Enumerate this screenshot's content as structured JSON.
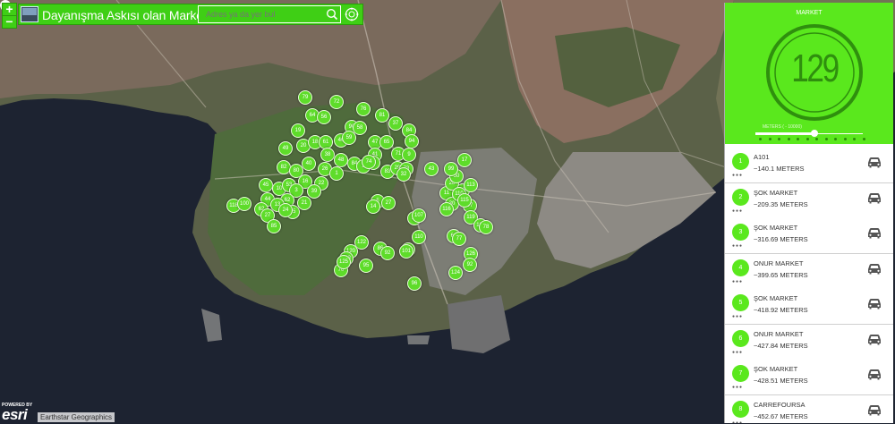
{
  "app": {
    "title": "Dayanışma Askısı olan Marketler",
    "zoom_in": "+",
    "zoom_out": "−",
    "search_placeholder": "Adres ya da yer bul",
    "icons": {
      "logo": "globe-logo-icon",
      "search": "search-icon",
      "locate": "locate-icon",
      "pin": "map-pin-icon"
    }
  },
  "map": {
    "powered_by": "POWERED BY",
    "esri_logo": "esri",
    "attribution": "Earthstar Geographics",
    "marker_color": "#5edc2a",
    "marker_labels": [
      "79",
      "72",
      "64",
      "56",
      "76",
      "81",
      "37",
      "90",
      "84",
      "58",
      "19",
      "46",
      "59",
      "94",
      "20",
      "49",
      "18",
      "61",
      "38",
      "47",
      "65",
      "41",
      "71",
      "9",
      "84",
      "63",
      "83",
      "29",
      "73",
      "48",
      "82",
      "40",
      "80",
      "26",
      "1",
      "2",
      "74",
      "22",
      "16",
      "39",
      "45",
      "10",
      "53",
      "3",
      "62",
      "44",
      "13",
      "35",
      "21",
      "62",
      "27",
      "24",
      "85",
      "118",
      "100",
      "5",
      "27",
      "14",
      "32",
      "43",
      "11",
      "30",
      "12",
      "107",
      "97",
      "15",
      "28",
      "50",
      "17",
      "99",
      "110",
      "113",
      "115",
      "119",
      "112",
      "78",
      "116",
      "68",
      "77",
      "11",
      "86",
      "122",
      "120",
      "123",
      "70",
      "125",
      "95",
      "92",
      "101",
      "126",
      "92",
      "124",
      "96",
      "110"
    ]
  },
  "panel": {
    "title": "MARKET",
    "count": "129",
    "slider_label": "METERS ( - 10000)",
    "slider_value": 0.55,
    "accent": "#5ae81d",
    "dots_count": 12,
    "list": [
      {
        "rank": "1",
        "name": "A101",
        "distance": "~140.1 METERS",
        "stars": "●●●"
      },
      {
        "rank": "2",
        "name": "ŞOK MARKET",
        "distance": "~209.35 METERS",
        "stars": "●●●"
      },
      {
        "rank": "3",
        "name": "ŞOK MARKET",
        "distance": "~316.69 METERS",
        "stars": "●●●"
      },
      {
        "rank": "4",
        "name": "ONUR MARKET",
        "distance": "~399.65 METERS",
        "stars": "●●●"
      },
      {
        "rank": "5",
        "name": "ŞOK MARKET",
        "distance": "~418.92 METERS",
        "stars": "●●●"
      },
      {
        "rank": "6",
        "name": "ONUR MARKET",
        "distance": "~427.84 METERS",
        "stars": "●●●"
      },
      {
        "rank": "7",
        "name": "ŞOK MARKET",
        "distance": "~428.51 METERS",
        "stars": "●●●"
      },
      {
        "rank": "8",
        "name": "CARREFOURSA",
        "distance": "~452.67 METERS",
        "stars": "●●●"
      }
    ],
    "car_icon": "car-icon"
  }
}
